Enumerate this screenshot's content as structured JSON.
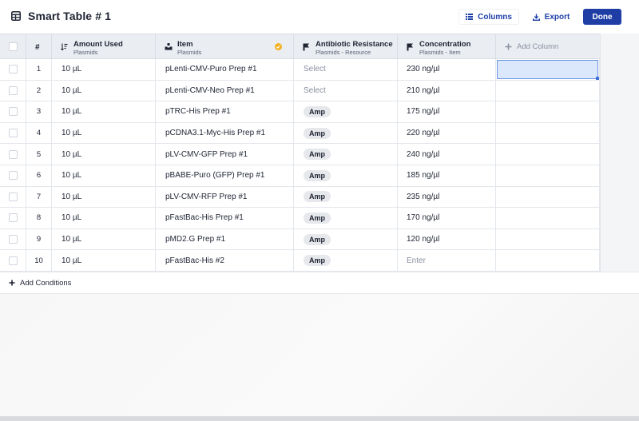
{
  "header": {
    "title": "Smart Table # 1",
    "columns_label": "Columns",
    "export_label": "Export",
    "done_label": "Done"
  },
  "table": {
    "number_header": "#",
    "columns": [
      {
        "key": "amount",
        "title": "Amount Used",
        "subtitle": "Plasmids",
        "icon": "sort-icon"
      },
      {
        "key": "item",
        "title": "Item",
        "subtitle": "Plasmids",
        "icon": "item-icon",
        "verified": true
      },
      {
        "key": "abx",
        "title": "Antibiotic Resistance",
        "subtitle": "Plasmids - Resource",
        "icon": "link-icon"
      },
      {
        "key": "conc",
        "title": "Concentration",
        "subtitle": "Plasmids - Item",
        "icon": "link-icon"
      }
    ],
    "add_column_label": "Add Column",
    "rows": [
      {
        "num": "1",
        "amount": "10 µL",
        "item": "pLenti-CMV-Puro Prep #1",
        "abx": "Select",
        "abx_type": "placeholder",
        "conc": "230 ng/µl",
        "conc_type": "value"
      },
      {
        "num": "2",
        "amount": "10 µL",
        "item": "pLenti-CMV-Neo Prep #1",
        "abx": "Select",
        "abx_type": "placeholder",
        "conc": "210 ng/µl",
        "conc_type": "value"
      },
      {
        "num": "3",
        "amount": "10 µL",
        "item": "pTRC-His Prep #1",
        "abx": "Amp",
        "abx_type": "pill",
        "conc": "175 ng/µl",
        "conc_type": "value"
      },
      {
        "num": "4",
        "amount": "10 µL",
        "item": "pCDNA3.1-Myc-His Prep #1",
        "abx": "Amp",
        "abx_type": "pill",
        "conc": "220 ng/µl",
        "conc_type": "value"
      },
      {
        "num": "5",
        "amount": "10 µL",
        "item": "pLV-CMV-GFP Prep #1",
        "abx": "Amp",
        "abx_type": "pill",
        "conc": "240 ng/µl",
        "conc_type": "value"
      },
      {
        "num": "6",
        "amount": "10 µL",
        "item": "pBABE-Puro (GFP) Prep #1",
        "abx": "Amp",
        "abx_type": "pill",
        "conc": "185 ng/µl",
        "conc_type": "value"
      },
      {
        "num": "7",
        "amount": "10 µL",
        "item": "pLV-CMV-RFP Prep #1",
        "abx": "Amp",
        "abx_type": "pill",
        "conc": "235 ng/µl",
        "conc_type": "value"
      },
      {
        "num": "8",
        "amount": "10 µL",
        "item": "pFastBac-His Prep #1",
        "abx": "Amp",
        "abx_type": "pill",
        "conc": "170 ng/µl",
        "conc_type": "value"
      },
      {
        "num": "9",
        "amount": "10 µL",
        "item": "pMD2.G Prep #1",
        "abx": "Amp",
        "abx_type": "pill",
        "conc": "120 ng/µl",
        "conc_type": "value"
      },
      {
        "num": "10",
        "amount": "10 µL",
        "item": "pFastBac-His #2",
        "abx": "Amp",
        "abx_type": "pill",
        "conc": "Enter",
        "conc_type": "placeholder"
      }
    ],
    "selected_cell": {
      "row": 0,
      "column": "new"
    }
  },
  "footer": {
    "add_conditions_label": "Add Conditions"
  },
  "colors": {
    "accent": "#1e3ea6",
    "header_bg": "#eaedf2",
    "selection_bg": "#dbe7fb",
    "selection_border": "#6e95e3",
    "verified": "#f2b01e"
  }
}
